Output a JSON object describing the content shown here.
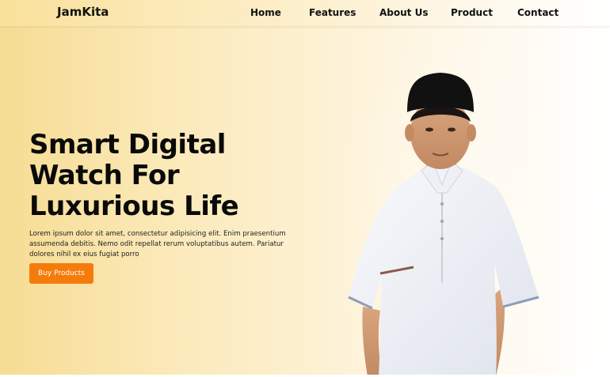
{
  "brand": {
    "name": "JamKita"
  },
  "nav": {
    "home": "Home",
    "features": "Features",
    "about": "About Us",
    "product": "Product",
    "contact": "Contact"
  },
  "hero": {
    "title_line1": "Smart Digital",
    "title_line2": "Watch For",
    "title_line3": "Luxurious Life",
    "description": "Lorem ipsum dolor sit amet, consectetur adipisicing elit. Enim praesentium assumenda debitis. Nemo odit repellat rerum voluptatibus autem. Pariatur dolores nihil ex eius fugiat porro",
    "button_label": "Buy Products"
  },
  "colors": {
    "accent": "#f57c0b",
    "background_left": "#f6dc93",
    "background_right": "#ffffff"
  }
}
